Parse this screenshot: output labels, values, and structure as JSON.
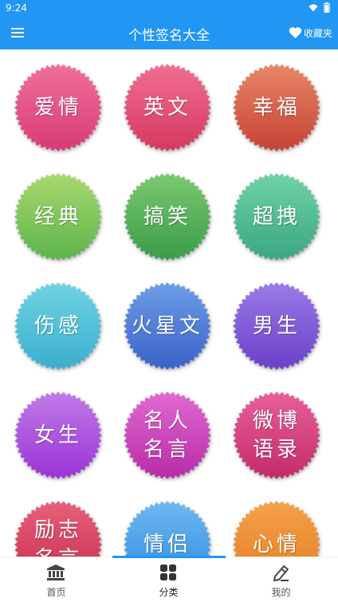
{
  "status": {
    "time": "9:24"
  },
  "app_bar": {
    "title": "个性签名大全",
    "favorites_label": "收藏夹",
    "menu_icon": "menu-icon",
    "favorites_icon": "heart-icon"
  },
  "categories": [
    {
      "label": "爱情",
      "color1": "#ef6f9a",
      "color2": "#d93a78"
    },
    {
      "label": "英文",
      "color1": "#ef6f92",
      "color2": "#d6385f"
    },
    {
      "label": "幸福",
      "color1": "#e98666",
      "color2": "#c54236"
    },
    {
      "label": "经典",
      "color1": "#a8d86e",
      "color2": "#5cb44b"
    },
    {
      "label": "搞笑",
      "color1": "#7bc86e",
      "color2": "#3a9c4a"
    },
    {
      "label": "超拽",
      "color1": "#6fd3a6",
      "color2": "#3aa682"
    },
    {
      "label": "伤感",
      "color1": "#6fd3e0",
      "color2": "#3aaecf"
    },
    {
      "label": "火星文",
      "color1": "#6d9de6",
      "color2": "#3a62c9"
    },
    {
      "label": "男生",
      "color1": "#9a7be6",
      "color2": "#6a3fc9"
    },
    {
      "label": "女生",
      "color1": "#c07be8",
      "color2": "#9a33d6"
    },
    {
      "label": "名人\n名言",
      "color1": "#e06ad0",
      "color2": "#b82aa8"
    },
    {
      "label": "微博\n语录",
      "color1": "#e8609a",
      "color2": "#c22a6a"
    },
    {
      "label": "励志\n名言",
      "color1": "#e8607a",
      "color2": "#c42a4a"
    },
    {
      "label": "情侣",
      "color1": "#6fb8f0",
      "color2": "#2e8ae0"
    },
    {
      "label": "心情",
      "color1": "#f4a24a",
      "color2": "#e57a1e"
    }
  ],
  "nav": {
    "items": [
      {
        "label": "首页",
        "icon": "bank-icon"
      },
      {
        "label": "分类",
        "icon": "grid-icon"
      },
      {
        "label": "我的",
        "icon": "edit-icon"
      }
    ],
    "active": "分类"
  }
}
